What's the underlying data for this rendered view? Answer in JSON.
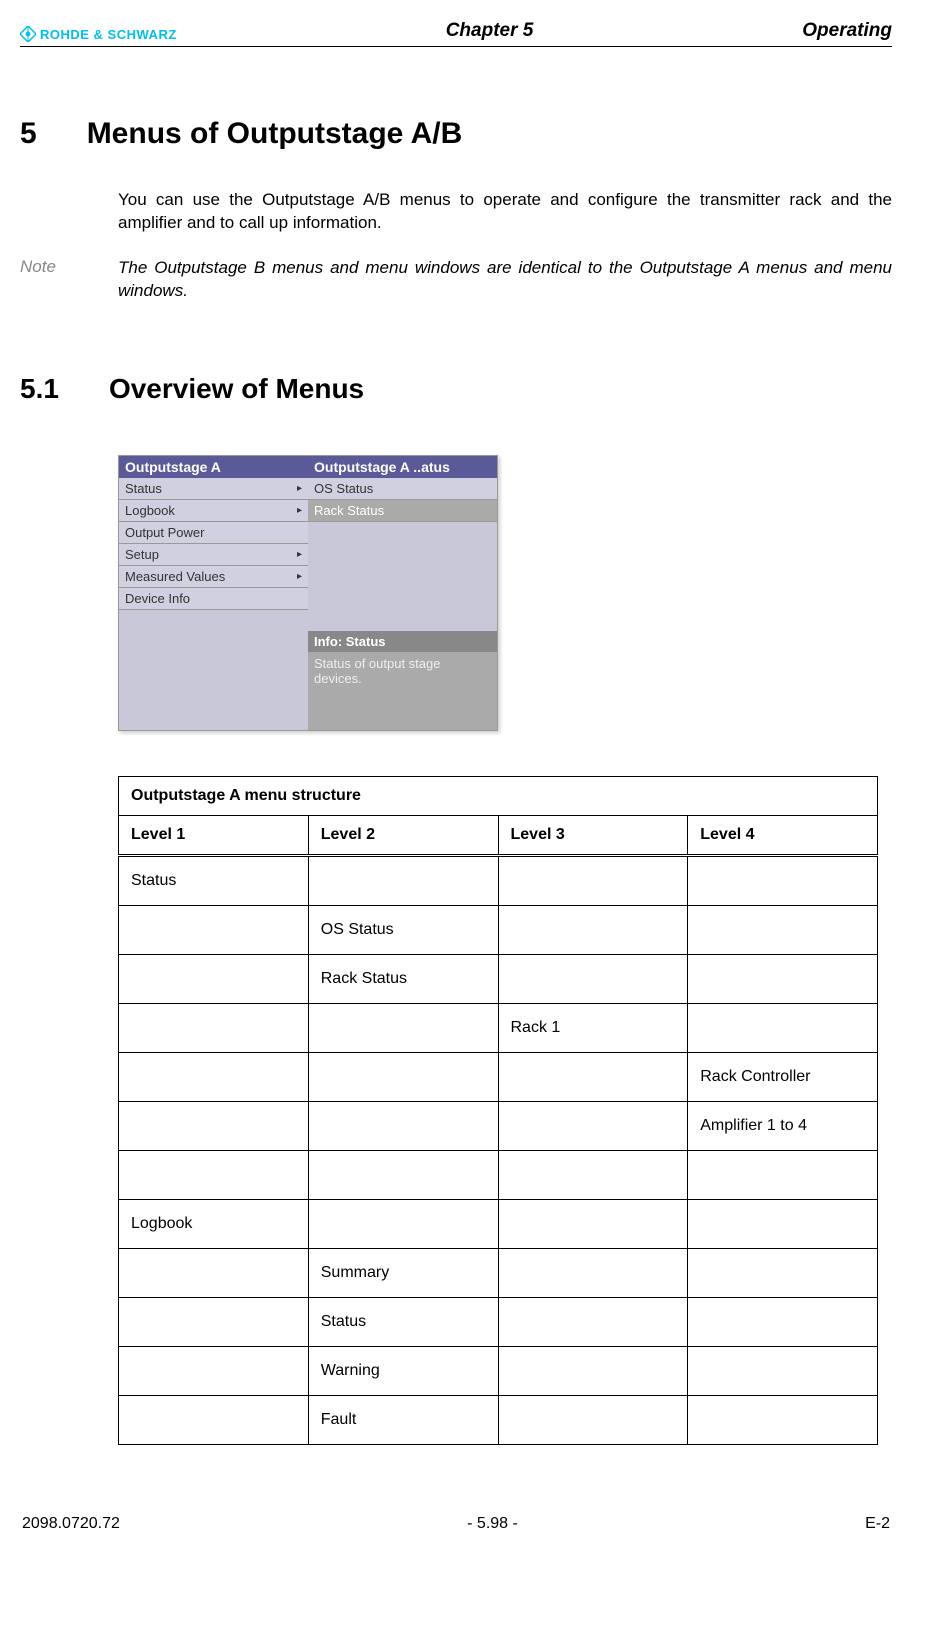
{
  "header": {
    "logo_text": "ROHDE & SCHWARZ",
    "center": "Chapter 5",
    "right": "Operating"
  },
  "h1": {
    "num": "5",
    "title": "Menus of Outputstage A/B"
  },
  "intro": "You can use the Outputstage A/B menus to operate and configure the transmitter rack and the amplifier and to call up information.",
  "note": {
    "label": "Note",
    "text": "The Outputstage B menus and menu windows are identical to the Outputstage A menus and menu windows."
  },
  "h2": {
    "num": "5.1",
    "title": "Overview of Menus"
  },
  "screenshot": {
    "left": {
      "header": "Outputstage A",
      "items": [
        "Status",
        "Logbook",
        "Output Power",
        "Setup",
        "Measured Values",
        "Device Info"
      ],
      "has_arrow": [
        true,
        true,
        false,
        true,
        true,
        false
      ]
    },
    "right": {
      "header": "Outputstage A ..atus",
      "items": [
        "OS Status",
        "Rack Status"
      ],
      "info_header": "Info: Status",
      "info_body": "Status of output stage devices."
    }
  },
  "table": {
    "title": "Outputstage A menu structure",
    "headers": [
      "Level 1",
      "Level 2",
      "Level 3",
      "Level 4"
    ],
    "rows": [
      [
        "Status",
        "",
        "",
        ""
      ],
      [
        "",
        "OS Status",
        "",
        ""
      ],
      [
        "",
        "Rack Status",
        "",
        ""
      ],
      [
        "",
        "",
        "Rack 1",
        ""
      ],
      [
        "",
        "",
        "",
        "Rack Controller"
      ],
      [
        "",
        "",
        "",
        "Amplifier 1 to 4"
      ],
      [
        "",
        "",
        "",
        ""
      ],
      [
        "Logbook",
        "",
        "",
        ""
      ],
      [
        "",
        "Summary",
        "",
        ""
      ],
      [
        "",
        "Status",
        "",
        ""
      ],
      [
        "",
        "Warning",
        "",
        ""
      ],
      [
        "",
        "Fault",
        "",
        ""
      ]
    ]
  },
  "footer": {
    "left": "2098.0720.72",
    "center": "- 5.98 -",
    "right": "E-2"
  }
}
